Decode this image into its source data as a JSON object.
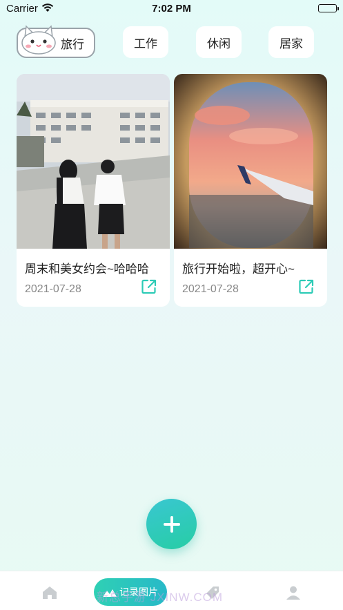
{
  "status_bar": {
    "carrier": "Carrier",
    "time": "7:02 PM"
  },
  "tabs": [
    {
      "label": "旅行",
      "active": true
    },
    {
      "label": "工作",
      "active": false
    },
    {
      "label": "休闲",
      "active": false
    },
    {
      "label": "居家",
      "active": false
    }
  ],
  "cards": [
    {
      "title": "周末和美女约会~哈哈哈",
      "date": "2021-07-28",
      "photo": "couple-walking-photo",
      "action_icon": "share-icon"
    },
    {
      "title": "旅行开始啦，超开心~",
      "date": "2021-07-28",
      "photo": "airplane-window-sunset-photo",
      "action_icon": "share-icon"
    }
  ],
  "fab": {
    "icon": "plus-icon"
  },
  "bottom_nav": {
    "record_label": "记录图片",
    "items": [
      "home-icon",
      "record-pill",
      "tag-icon",
      "profile-icon"
    ]
  },
  "watermark": "新总手游 JXINW.COM",
  "colors": {
    "accent": "#2ccbb6",
    "accent_2": "#27b9c8",
    "text": "#222222",
    "muted": "#888888"
  }
}
